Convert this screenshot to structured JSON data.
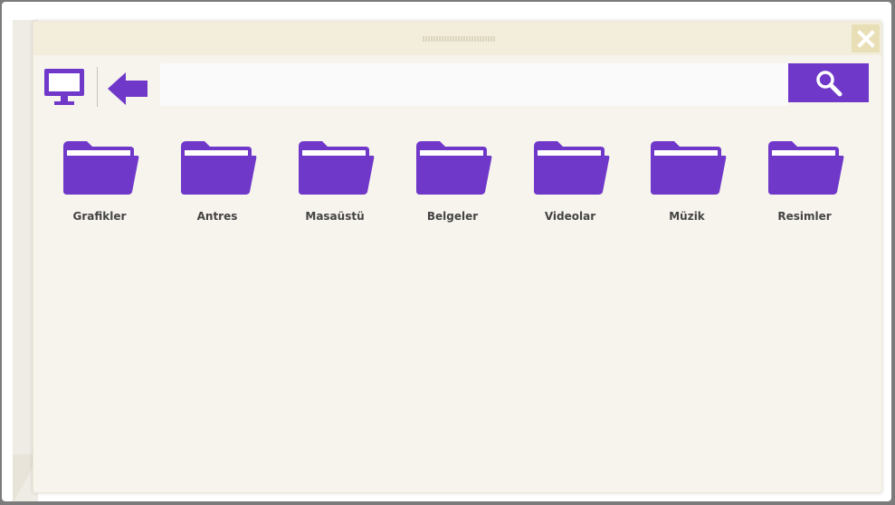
{
  "window": {
    "close_label": "close"
  },
  "toolbar": {
    "monitor_icon": "monitor-icon",
    "back_icon": "back-arrow-icon",
    "search_icon": "search-icon",
    "search": {
      "value": "",
      "placeholder": ""
    }
  },
  "colors": {
    "accent": "#6f38c9",
    "window_bg": "#f7f4ee",
    "titlebar_bg": "#f3eddb",
    "close_bg": "#e9dfb6"
  },
  "folders": [
    {
      "label": "Grafikler",
      "icon": "folder-icon"
    },
    {
      "label": "Antres",
      "icon": "folder-icon"
    },
    {
      "label": "Masaüstü",
      "icon": "folder-icon"
    },
    {
      "label": "Belgeler",
      "icon": "folder-icon"
    },
    {
      "label": "Videolar",
      "icon": "folder-icon"
    },
    {
      "label": "Müzik",
      "icon": "folder-icon"
    },
    {
      "label": "Resimler",
      "icon": "folder-icon"
    }
  ]
}
